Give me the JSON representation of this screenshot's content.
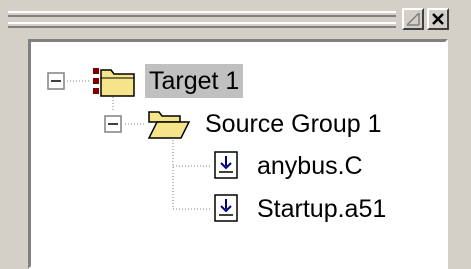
{
  "window": {
    "dropdown_icon": "dropdown-arrow-icon",
    "close_icon": "close-icon"
  },
  "tree": {
    "target": {
      "label": "Target 1",
      "expanded": true,
      "selected": true,
      "icon": "target-folder-icon"
    },
    "group": {
      "label": "Source Group 1",
      "expanded": true,
      "icon": "open-folder-icon"
    },
    "files": [
      {
        "label": "anybus.C",
        "icon": "source-file-icon"
      },
      {
        "label": "Startup.a51",
        "icon": "source-file-icon"
      }
    ]
  },
  "colors": {
    "face": "#d4d0c8",
    "panel_bg": "#ffffff",
    "selection": "#c0c0c0",
    "folder": "#f6e48a",
    "target_red": "#800000"
  }
}
